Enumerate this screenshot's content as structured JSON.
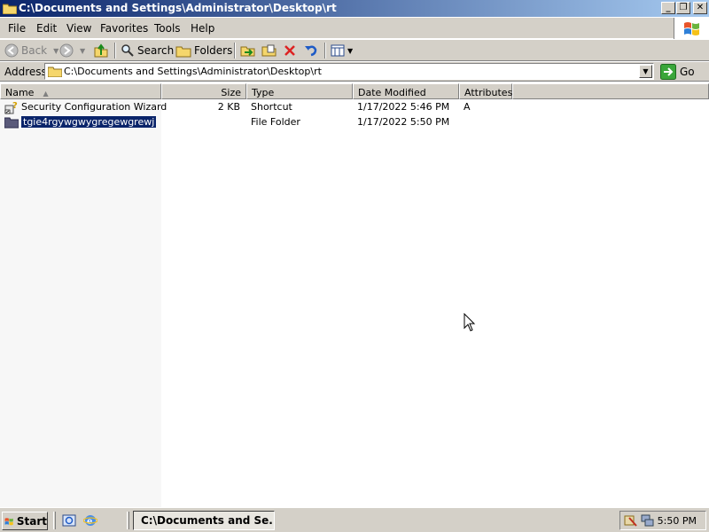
{
  "window": {
    "title": "C:\\Documents and Settings\\Administrator\\Desktop\\rt",
    "controls": [
      "minimize",
      "restore",
      "close"
    ]
  },
  "menu": {
    "items": [
      "File",
      "Edit",
      "View",
      "Favorites",
      "Tools",
      "Help"
    ]
  },
  "toolbar": {
    "back_label": "Back",
    "search_label": "Search",
    "folders_label": "Folders"
  },
  "address": {
    "label": "Address",
    "value": "C:\\Documents and Settings\\Administrator\\Desktop\\rt",
    "go_label": "Go"
  },
  "list": {
    "columns": [
      "Name",
      "Size",
      "Type",
      "Date Modified",
      "Attributes"
    ],
    "sort_column": "Name",
    "rows": [
      {
        "name": "Security Configuration Wizard",
        "size": "2 KB",
        "type": "Shortcut",
        "date": "1/17/2022 5:46 PM",
        "attributes": "A",
        "icon": "shortcut-wizard-icon",
        "selected": false
      },
      {
        "name": "tgie4rgywgwygregewgrewj",
        "size": "",
        "type": "File Folder",
        "date": "1/17/2022 5:50 PM",
        "attributes": "",
        "icon": "folder-icon",
        "selected": true
      }
    ]
  },
  "taskbar": {
    "start_label": "Start",
    "active_task": "C:\\Documents and Se...",
    "clock": "5:50 PM"
  },
  "colors": {
    "title_start": "#0a246a",
    "title_end": "#a6caf0",
    "chrome": "#d4d0c8",
    "selection": "#0a246a"
  }
}
